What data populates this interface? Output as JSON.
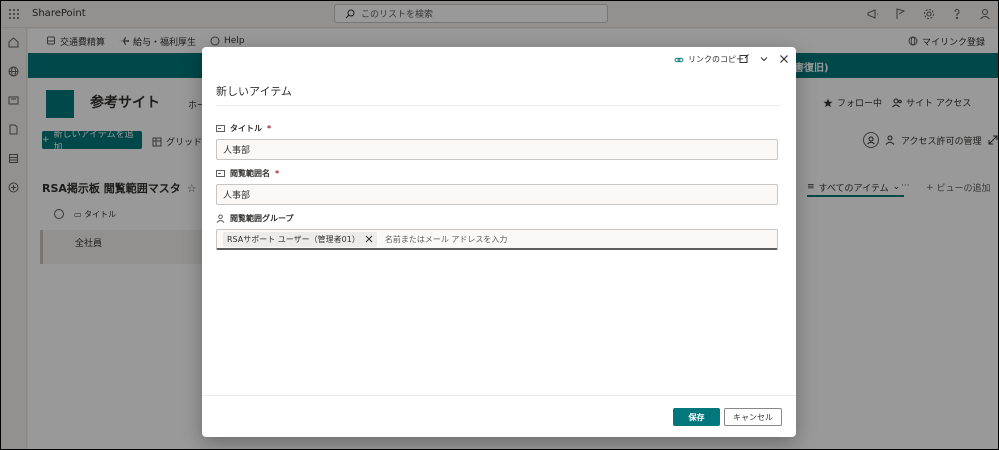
{
  "suitebar": {
    "brand": "SharePoint",
    "search_placeholder": "このリストを検索"
  },
  "hubnav": {
    "items": [
      {
        "label": "交通費精算"
      },
      {
        "label": "給与・福利厚生"
      },
      {
        "label": "Help"
      }
    ],
    "my_links": "マイリンク登録"
  },
  "banner": {
    "text": "害復旧)"
  },
  "site": {
    "title": "参考サイト",
    "nav_fragment": "ホー",
    "follow": "フォロー中",
    "site_access": "サイト アクセス"
  },
  "commandbar": {
    "new_item": "新しいアイテムを追加",
    "grid_view": "グリッド ビ",
    "access_manage": "アクセス許可の管理"
  },
  "list": {
    "title": "RSA掲示板 閲覧範囲マスタ",
    "view_name": "すべてのアイテム",
    "more": "···",
    "add_view": "ビューの追加",
    "column_title": "タイトル",
    "rows": [
      {
        "title": "全社員"
      }
    ]
  },
  "dialog": {
    "copy_link": "リンクのコピー",
    "title": "新しいアイテム",
    "fields": {
      "title": {
        "label": "タイトル",
        "required": "*",
        "value": "人事部"
      },
      "scope_name": {
        "label": "閲覧範囲名",
        "required": "*",
        "value": "人事部"
      },
      "scope_group": {
        "label": "閲覧範囲グループ",
        "pill": "RSAサポート ユーザー（管理者01）",
        "placeholder": "名前またはメール アドレスを入力"
      }
    },
    "save": "保存",
    "cancel": "キャンセル"
  },
  "colors": {
    "accent": "#03787c",
    "overlay": "rgba(0,0,0,0.4)",
    "required": "#a4262c"
  }
}
